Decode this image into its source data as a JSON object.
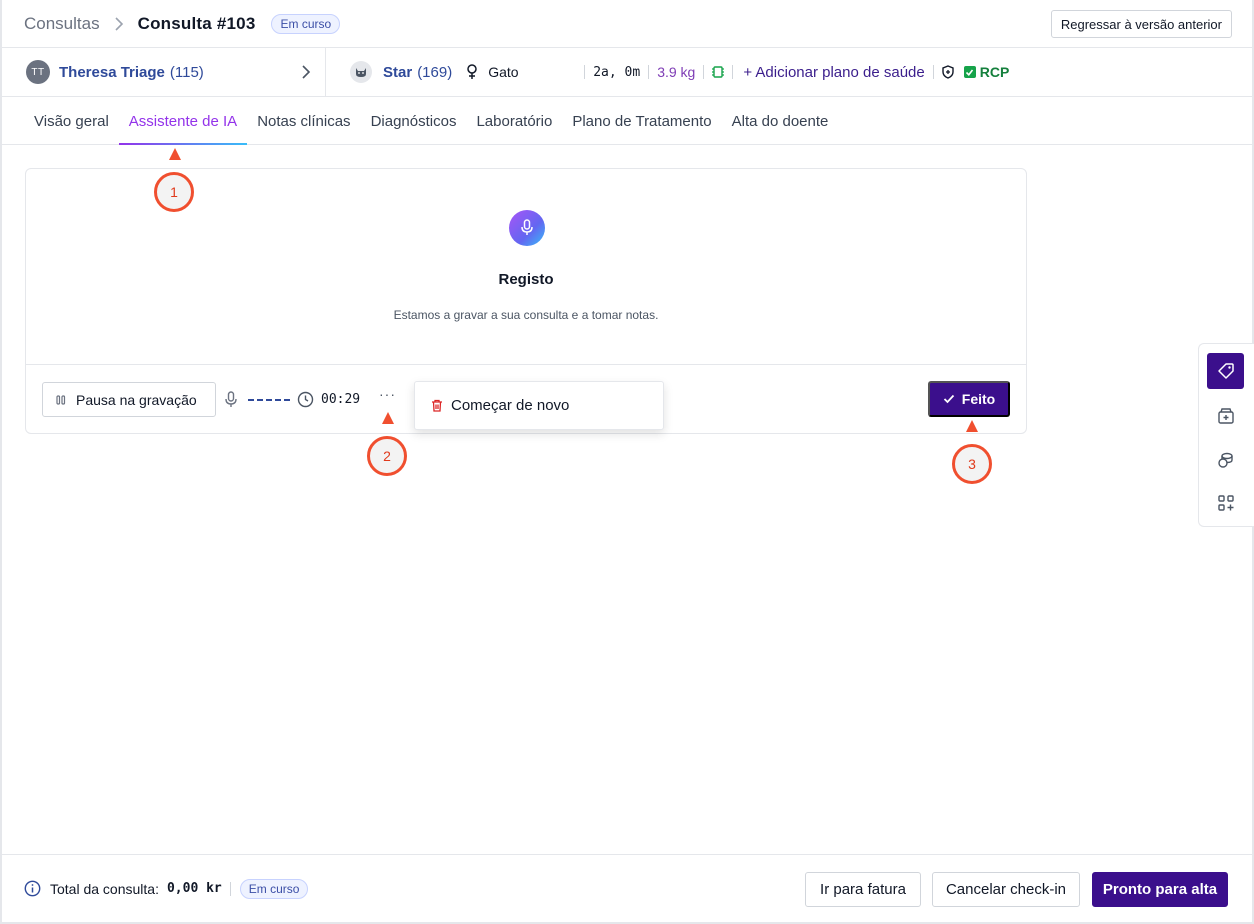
{
  "breadcrumb": {
    "root": "Consultas",
    "current": "Consulta #103",
    "status": "Em curso"
  },
  "header": {
    "revert_label": "Regressar à versão anterior"
  },
  "owner": {
    "initials": "TT",
    "name": "Theresa Triage",
    "count": "(115)"
  },
  "pet": {
    "icon": "cat-icon",
    "name": "Star",
    "count": "(169)",
    "sex_icon": "female-icon",
    "species": "Gato",
    "age": "2a, 0m",
    "weight": "3.9 kg",
    "add_plan": "+ Adicionar plano de saúde",
    "rcp": "RCP"
  },
  "tabs": [
    {
      "label": "Visão geral",
      "active": false
    },
    {
      "label": "Assistente de IA",
      "active": true
    },
    {
      "label": "Notas clínicas",
      "active": false
    },
    {
      "label": "Diagnósticos",
      "active": false
    },
    {
      "label": "Laboratório",
      "active": false
    },
    {
      "label": "Plano de Tratamento",
      "active": false
    },
    {
      "label": "Alta do doente",
      "active": false
    }
  ],
  "recording": {
    "title": "Registo",
    "subtitle": "Estamos a gravar a sua consulta e a tomar notas.",
    "pause_label": "Pausa na gravação",
    "timer": "00:29",
    "more": "···",
    "done_label": "Feito"
  },
  "menu": {
    "restart_label": "Começar de novo"
  },
  "markers": [
    "1",
    "2",
    "3"
  ],
  "rail": {
    "icons": [
      "tag-icon",
      "archive-plus-icon",
      "coins-icon",
      "apps-plus-icon"
    ]
  },
  "footer": {
    "total_label": "Total da consulta:",
    "total_value": "0,00 kr",
    "status": "Em curso",
    "invoice_label": "Ir para fatura",
    "cancel_label": "Cancelar check-in",
    "discharge_label": "Pronto para alta"
  },
  "colors": {
    "accent": "#3b0f8c",
    "tab_active": "#9333ea",
    "link": "#2f4a9a",
    "marker": "#f04f2f",
    "rcp": "#15803d"
  }
}
